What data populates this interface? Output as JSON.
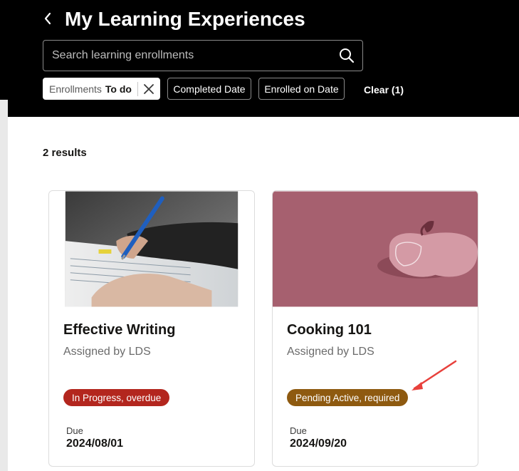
{
  "header": {
    "title": "My Learning Experiences",
    "back_icon": "chevron-left-icon"
  },
  "search": {
    "placeholder": "Search learning enrollments",
    "value": "",
    "icon": "search-icon"
  },
  "filters": {
    "active_chip": {
      "label": "Enrollments",
      "value": "To do",
      "clear_icon": "close-icon"
    },
    "chips": [
      "Completed Date",
      "Enrolled on Date"
    ],
    "clear_label": "Clear (1)"
  },
  "results": {
    "count_label": "2 results"
  },
  "cards": [
    {
      "title": "Effective Writing",
      "assigned": "Assigned by LDS",
      "status": "In Progress, overdue",
      "status_color": "#b3261e",
      "due_label": "Due",
      "due_date": "2024/08/01",
      "image": "writing-photo"
    },
    {
      "title": "Cooking 101",
      "assigned": "Assigned by LDS",
      "status": "Pending Active, required",
      "status_color": "#8e5a10",
      "due_label": "Due",
      "due_date": "2024/09/20",
      "image": "apple-illustration",
      "annotation": "red-arrow"
    }
  ],
  "colors": {
    "header_bg": "#000000",
    "card_image_bg": "#a6606f",
    "annotation_arrow": "#e8413c"
  }
}
